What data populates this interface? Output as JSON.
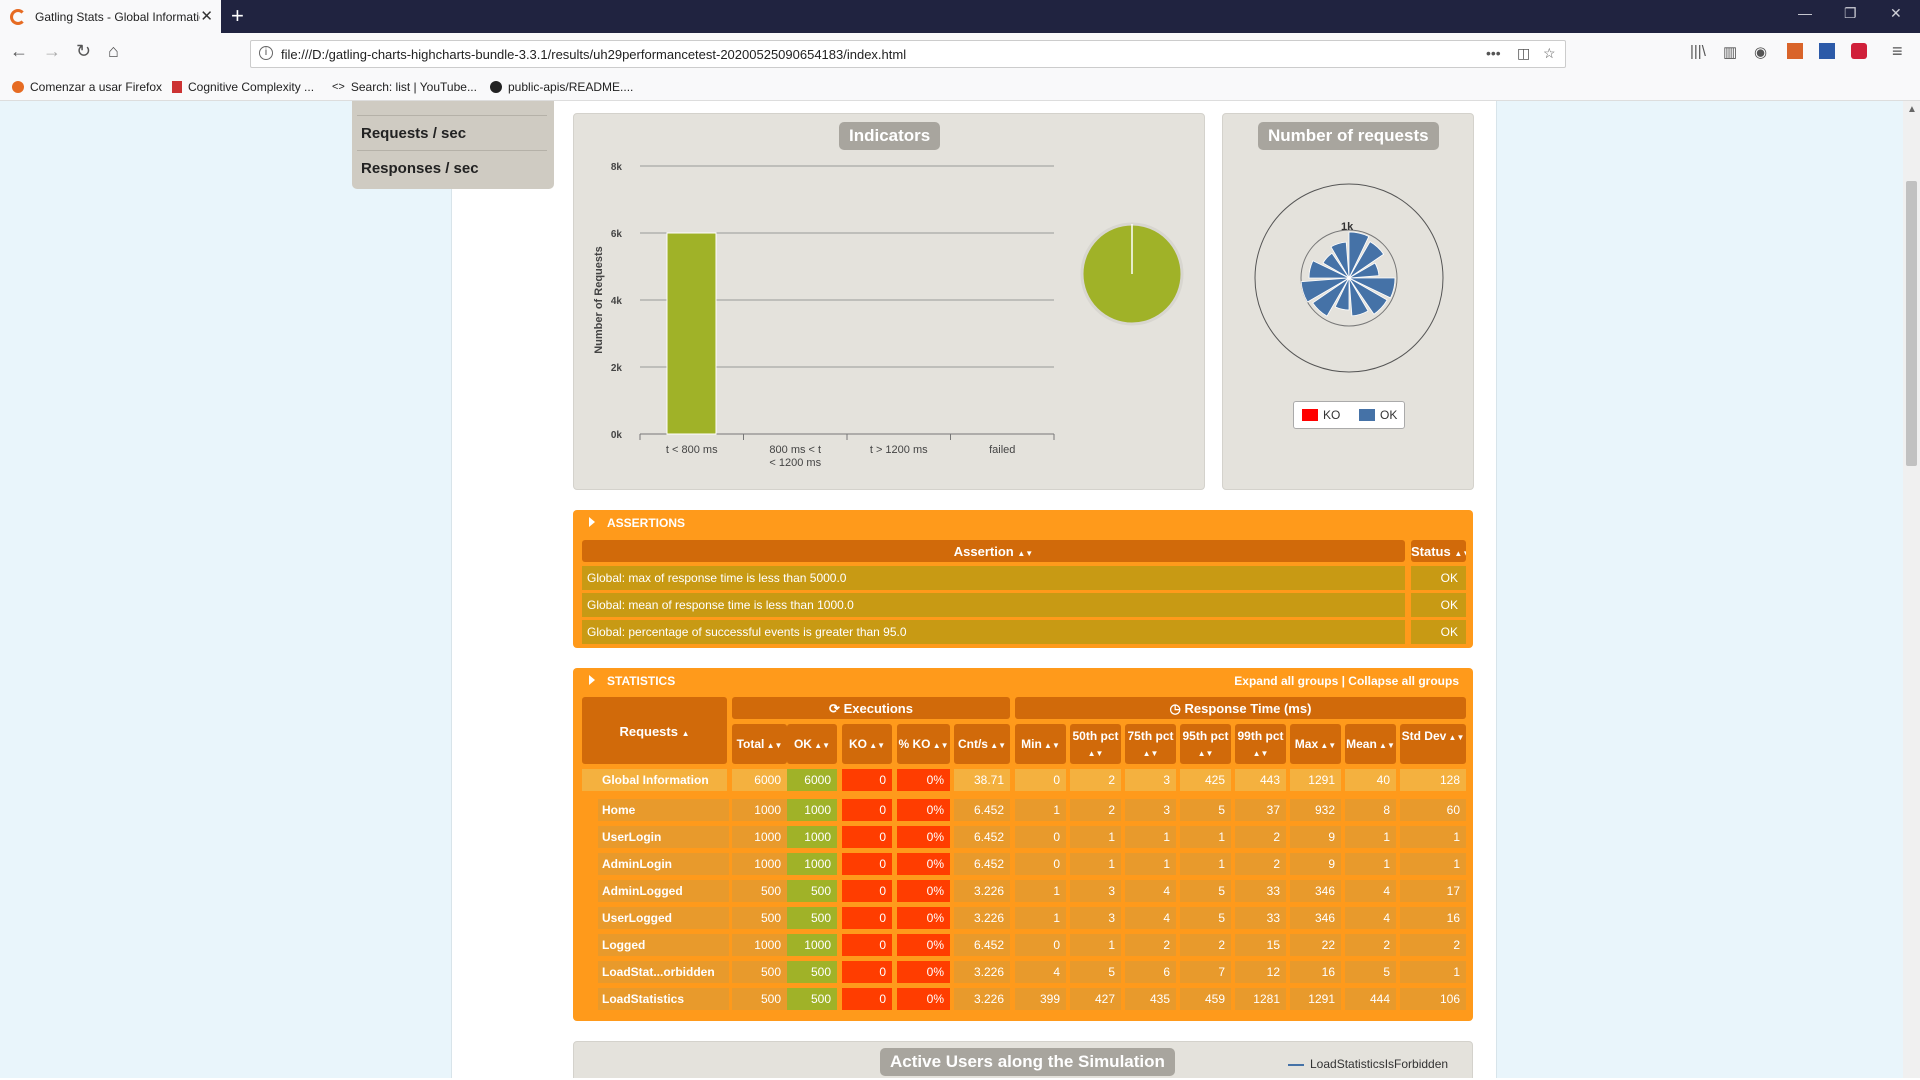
{
  "browser": {
    "tab_title": "Gatling Stats - Global Informatio",
    "url": "file:///D:/gatling-charts-highcharts-bundle-3.3.1/results/uh29performancetest-20200525090654183/index.html",
    "bookmarks": [
      "Comenzar a usar Firefox",
      "Cognitive Complexity ...",
      "Search: list  |  YouTube...",
      "public-apis/README...."
    ]
  },
  "menu": {
    "items": [
      "Requests / sec",
      "Responses / sec"
    ]
  },
  "indicators": {
    "title": "Indicators",
    "chart_data": {
      "type": "bar",
      "ylabel": "Number of Requests",
      "categories": [
        "t < 800 ms",
        "800 ms < t < 1200 ms",
        "t > 1200 ms",
        "failed"
      ],
      "values": [
        6000,
        0,
        0,
        0
      ],
      "ylim": [
        0,
        8000
      ],
      "y_ticks": [
        "0k",
        "2k",
        "4k",
        "6k",
        "8k"
      ],
      "bar_color": "#a0b228",
      "grid": true
    }
  },
  "requests_chart": {
    "title": "Number of requests",
    "ring_label": "1k",
    "legend": [
      {
        "label": "KO",
        "color": "#ff0000"
      },
      {
        "label": "OK",
        "color": "#4572a7"
      }
    ]
  },
  "assertions": {
    "header": "ASSERTIONS",
    "col_assertion": "Assertion",
    "col_status": "Status",
    "rows": [
      {
        "text": "Global: max of response time is less than 5000.0",
        "status": "OK"
      },
      {
        "text": "Global: mean of response time is less than 1000.0",
        "status": "OK"
      },
      {
        "text": "Global: percentage of successful events is greater than 95.0",
        "status": "OK"
      }
    ]
  },
  "statistics": {
    "header": "STATISTICS",
    "links": "Expand all groups | Collapse all groups",
    "executions_label": "Executions",
    "response_label": "Response Time (ms)",
    "requests_label": "Requests",
    "columns": [
      "Total",
      "OK",
      "KO",
      "% KO",
      "Cnt/s",
      "Min",
      "50th pct",
      "75th pct",
      "95th pct",
      "99th pct",
      "Max",
      "Mean",
      "Std Dev"
    ],
    "global": [
      "Global Information",
      "6000",
      "6000",
      "0",
      "0%",
      "38.71",
      "0",
      "2",
      "3",
      "425",
      "443",
      "1291",
      "40",
      "128"
    ],
    "rows": [
      [
        "Home",
        "1000",
        "1000",
        "0",
        "0%",
        "6.452",
        "1",
        "2",
        "3",
        "5",
        "37",
        "932",
        "8",
        "60"
      ],
      [
        "UserLogin",
        "1000",
        "1000",
        "0",
        "0%",
        "6.452",
        "0",
        "1",
        "1",
        "1",
        "2",
        "9",
        "1",
        "1"
      ],
      [
        "AdminLogin",
        "1000",
        "1000",
        "0",
        "0%",
        "6.452",
        "0",
        "1",
        "1",
        "1",
        "2",
        "9",
        "1",
        "1"
      ],
      [
        "AdminLogged",
        "500",
        "500",
        "0",
        "0%",
        "3.226",
        "1",
        "3",
        "4",
        "5",
        "33",
        "346",
        "4",
        "17"
      ],
      [
        "UserLogged",
        "500",
        "500",
        "0",
        "0%",
        "3.226",
        "1",
        "3",
        "4",
        "5",
        "33",
        "346",
        "4",
        "16"
      ],
      [
        "Logged",
        "1000",
        "1000",
        "0",
        "0%",
        "6.452",
        "0",
        "1",
        "2",
        "2",
        "15",
        "22",
        "2",
        "2"
      ],
      [
        "LoadStat...orbidden",
        "500",
        "500",
        "0",
        "0%",
        "3.226",
        "4",
        "5",
        "6",
        "7",
        "12",
        "16",
        "5",
        "1"
      ],
      [
        "LoadStatistics",
        "500",
        "500",
        "0",
        "0%",
        "3.226",
        "399",
        "427",
        "435",
        "459",
        "1281",
        "1291",
        "444",
        "106"
      ]
    ]
  },
  "active_users": {
    "title": "Active Users along the Simulation",
    "legend_item": "LoadStatisticsIsForbidden"
  },
  "colors": {
    "orange": "#ff9a1b",
    "header": "#d16a0a",
    "ko_red": "#ff3d00",
    "ok_green": "#a0b228"
  }
}
